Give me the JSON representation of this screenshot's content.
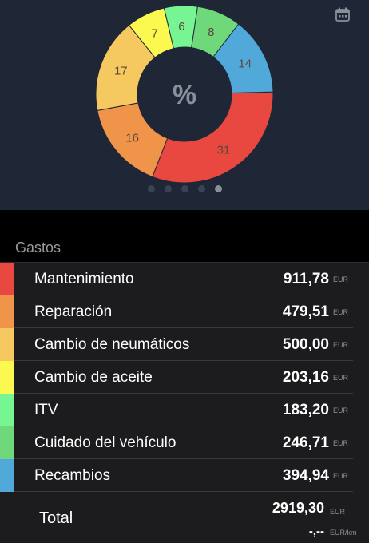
{
  "header": {
    "calendar_icon": "calendar-icon",
    "center_label": "%"
  },
  "chart_data": {
    "type": "pie",
    "values": [
      31,
      16,
      17,
      7,
      6,
      8,
      14
    ],
    "labels": [
      "31",
      "16",
      "17",
      "7",
      "6",
      "8",
      "14"
    ],
    "colors": [
      "#e8483f",
      "#f0944a",
      "#f5c95f",
      "#fbf84f",
      "#77f593",
      "#6fd87b",
      "#50a9d8"
    ]
  },
  "pager": {
    "count": 5,
    "active_index": 4
  },
  "section_title": "Gastos",
  "expenses": [
    {
      "label": "Mantenimiento",
      "amount": "911,78",
      "unit": "EUR",
      "color": "#e8483f"
    },
    {
      "label": "Reparación",
      "amount": "479,51",
      "unit": "EUR",
      "color": "#f0944a"
    },
    {
      "label": "Cambio de neumáticos",
      "amount": "500,00",
      "unit": "EUR",
      "color": "#f5c95f"
    },
    {
      "label": "Cambio de aceite",
      "amount": "203,16",
      "unit": "EUR",
      "color": "#fbf84f"
    },
    {
      "label": "ITV",
      "amount": "183,20",
      "unit": "EUR",
      "color": "#77f593"
    },
    {
      "label": "Cuidado del vehículo",
      "amount": "246,71",
      "unit": "EUR",
      "color": "#6fd87b"
    },
    {
      "label": "Recambios",
      "amount": "394,94",
      "unit": "EUR",
      "color": "#50a9d8"
    }
  ],
  "total": {
    "label": "Total",
    "amount": "2919,30",
    "unit": "EUR",
    "per_km_amount": "-,--",
    "per_km_unit": "EUR/km"
  }
}
